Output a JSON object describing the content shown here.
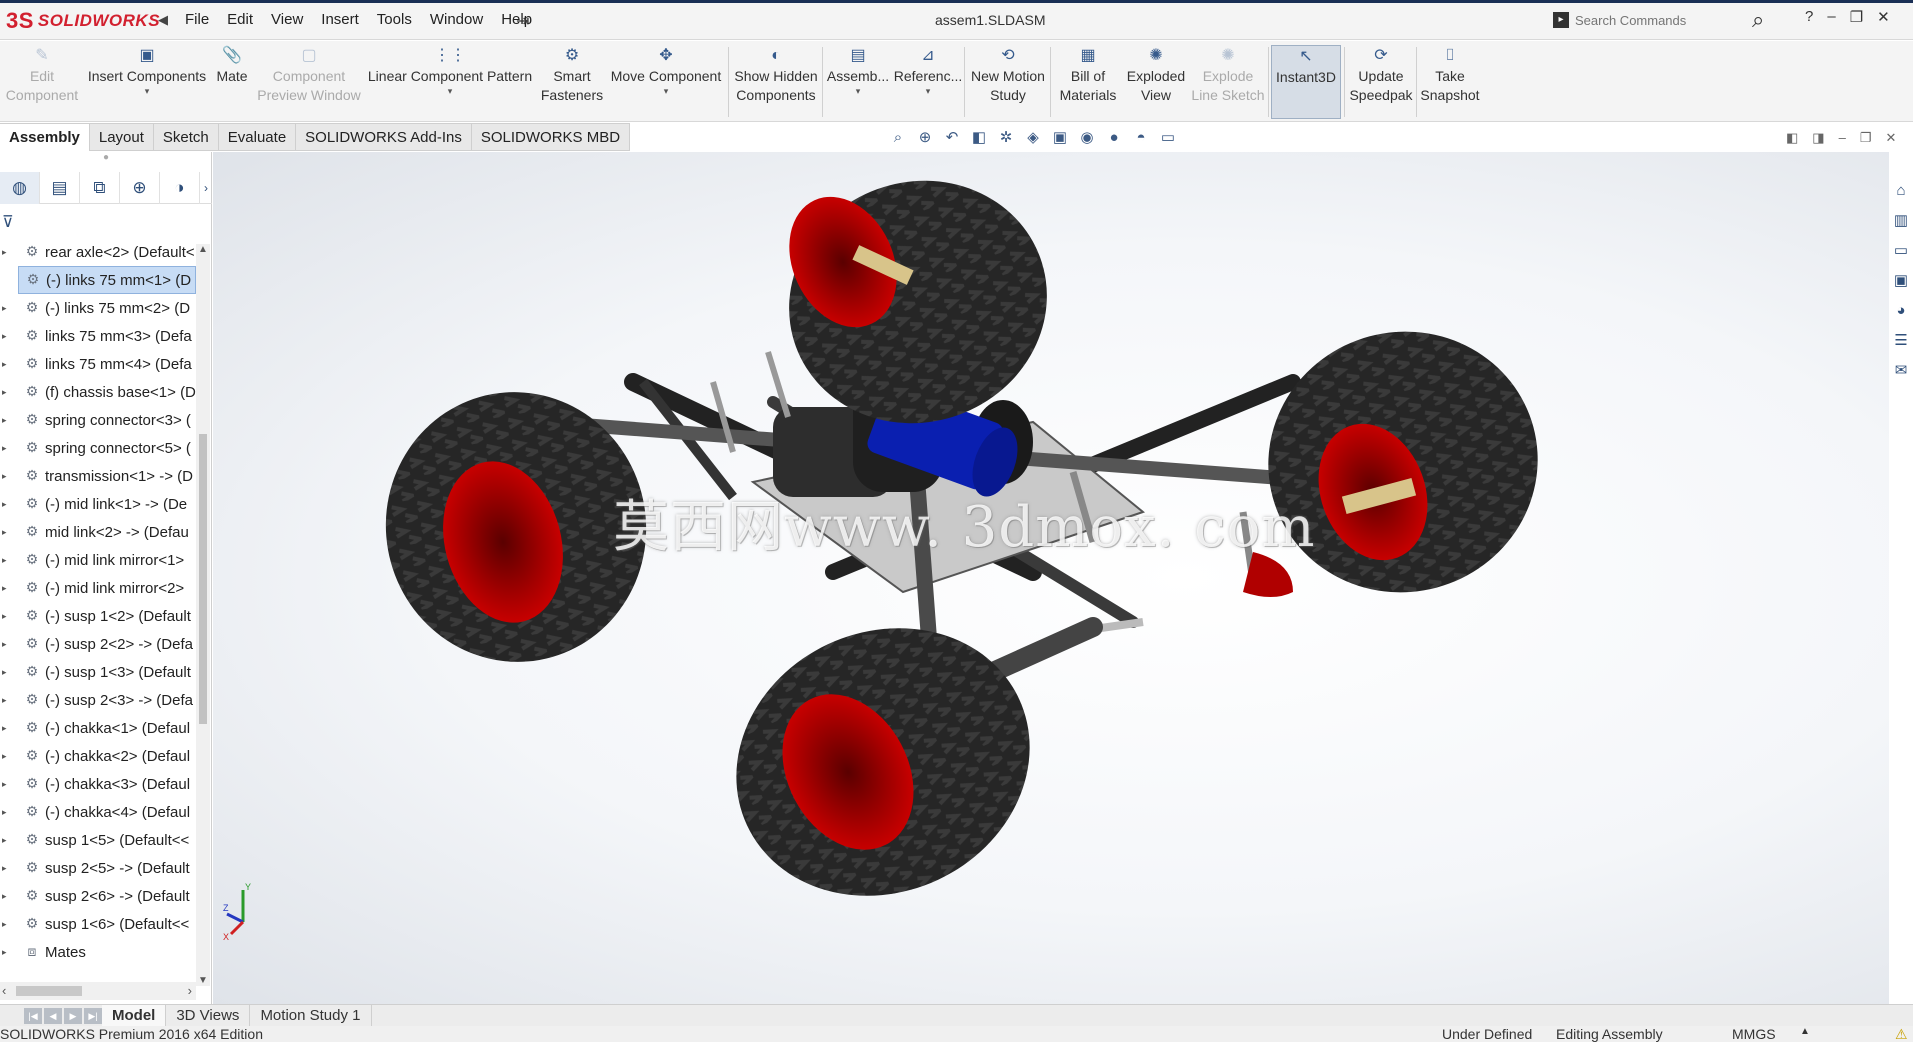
{
  "app": {
    "logo_text": "SOLIDWORKS",
    "logo_mark": "3S",
    "document_title": "assem1.SLDASM"
  },
  "menu": [
    "File",
    "Edit",
    "View",
    "Insert",
    "Tools",
    "Window",
    "Help"
  ],
  "search": {
    "placeholder": "Search Commands"
  },
  "commands": [
    {
      "label1": "Edit",
      "label2": "Component",
      "disabled": true
    },
    {
      "label1": "Insert Components",
      "label2": "",
      "dropdown": true
    },
    {
      "label1": "Mate",
      "label2": ""
    },
    {
      "label1": "Component",
      "label2": "Preview Window",
      "disabled": true
    },
    {
      "label1": "Linear Component Pattern",
      "label2": "",
      "dropdown": true
    },
    {
      "label1": "Smart",
      "label2": "Fasteners"
    },
    {
      "label1": "Move Component",
      "label2": "",
      "dropdown": true
    },
    {
      "label1": "Show Hidden",
      "label2": "Components"
    },
    {
      "label1": "Assemb...",
      "label2": "",
      "dropdown": true
    },
    {
      "label1": "Referenc...",
      "label2": "",
      "dropdown": true
    },
    {
      "label1": "New Motion",
      "label2": "Study"
    },
    {
      "label1": "Bill of",
      "label2": "Materials"
    },
    {
      "label1": "Exploded",
      "label2": "View"
    },
    {
      "label1": "Explode",
      "label2": "Line Sketch",
      "disabled": true
    },
    {
      "label1": "Instant3D",
      "label2": "",
      "active": true
    },
    {
      "label1": "Update",
      "label2": "Speedpak"
    },
    {
      "label1": "Take",
      "label2": "Snapshot"
    }
  ],
  "cm_tabs": [
    "Assembly",
    "Layout",
    "Sketch",
    "Evaluate",
    "SOLIDWORKS Add-Ins",
    "SOLIDWORKS MBD"
  ],
  "tree": {
    "items": [
      "rear axle<2> (Default<",
      "(-) links 75 mm<1> (D",
      "(-) links 75 mm<2> (D",
      "links 75 mm<3> (Defa",
      "links 75 mm<4> (Defa",
      "(f) chassis base<1> (D",
      "spring connector<3> (",
      "spring connector<5> (",
      "transmission<1> -> (D",
      "(-) mid link<1> -> (De",
      "mid link<2> -> (Defau",
      "(-) mid link mirror<1>",
      "(-) mid link mirror<2>",
      "(-) susp 1<2> (Default",
      "(-) susp 2<2> -> (Defa",
      "(-) susp 1<3> (Default",
      "(-) susp 2<3> -> (Defa",
      "(-) chakka<1> (Defaul",
      "(-) chakka<2> (Defaul",
      "(-) chakka<3> (Defaul",
      "(-) chakka<4> (Defaul",
      "susp 1<5> (Default<<",
      "susp 2<5> -> (Default",
      "susp 2<6> -> (Default",
      "susp 1<6> (Default<<",
      "Mates"
    ]
  },
  "viewport": {
    "watermark": "莫西网www. 3dmox. com",
    "triad_y": "Y",
    "triad_z": "Z",
    "triad_x": "X"
  },
  "bottom_tabs": [
    "Model",
    "3D Views",
    "Motion Study 1"
  ],
  "status": {
    "edition": "SOLIDWORKS Premium 2016 x64 Edition",
    "definition": "Under Defined",
    "mode": "Editing Assembly",
    "units": "MMGS"
  }
}
